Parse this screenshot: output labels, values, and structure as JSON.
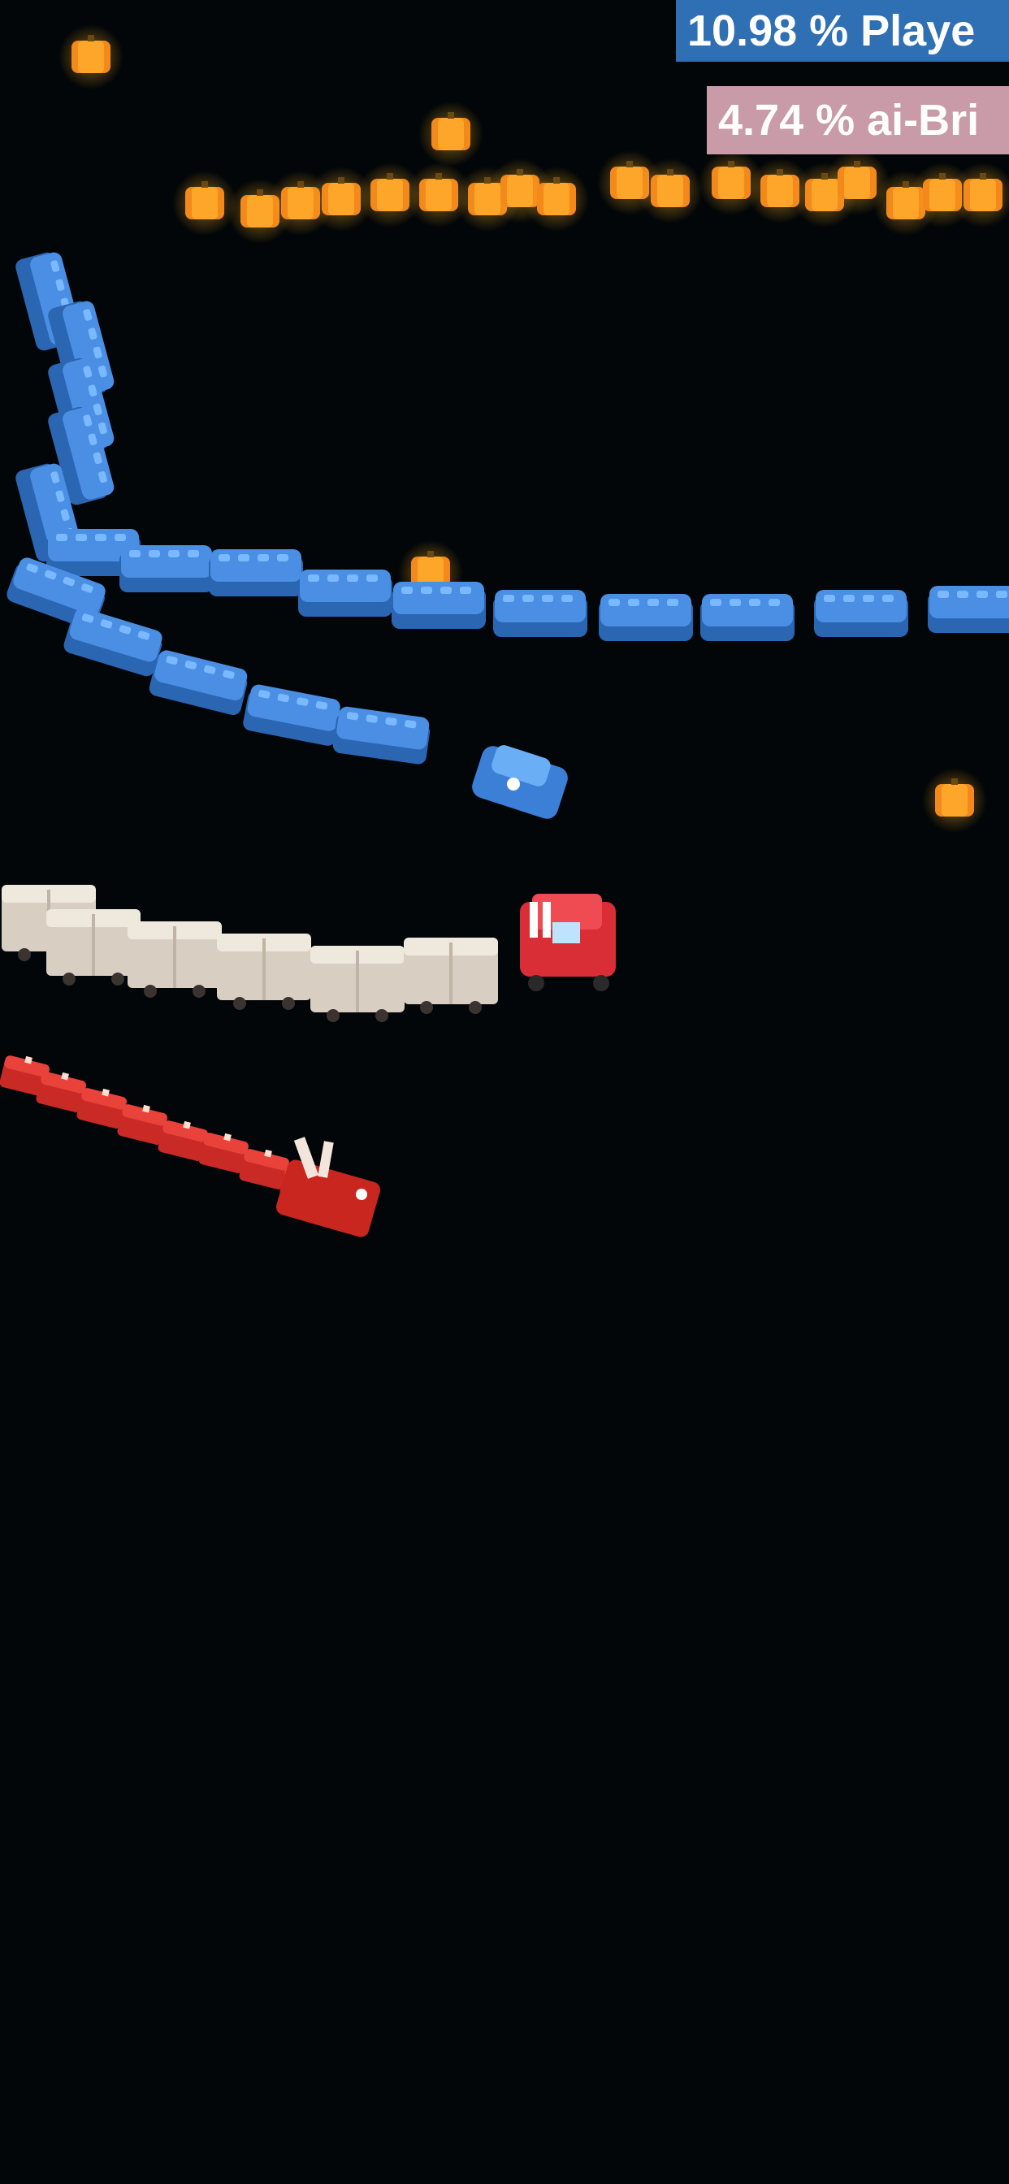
{
  "leaderboard": {
    "entries": [
      {
        "text": "10.98 % Playe",
        "color": "#2f6fb3"
      },
      {
        "text": "4.74 % ai-Bri",
        "color": "#c99aa8"
      }
    ]
  },
  "scene": {
    "background": "#020608",
    "colors": {
      "pumpkin": "#f79a1e",
      "pumpkin_glow": "#ffb020",
      "blue_train": "#3b82d6",
      "blue_train_top": "#5ea4f0",
      "cream_wagon": "#e6ddd0",
      "red_truck": "#e0343b",
      "red_dragon": "#d9312c"
    },
    "icons": [
      "pumpkin-icon",
      "blue-train-snake",
      "truck-snake",
      "dragon-snake"
    ]
  }
}
